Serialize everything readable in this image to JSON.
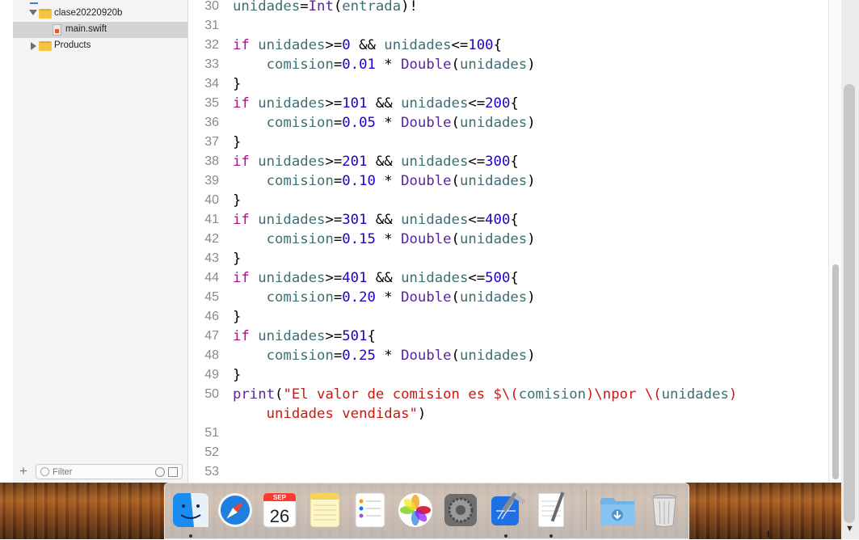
{
  "navigator": {
    "items": [
      {
        "label": "clase20220920b",
        "kind": "group"
      },
      {
        "label": "main.swift",
        "kind": "file"
      },
      {
        "label": "Products",
        "kind": "group"
      }
    ],
    "filter_placeholder": "Filter"
  },
  "editor": {
    "lines": [
      {
        "n": "30",
        "tokens": [
          {
            "t": "unidades",
            "c": "id"
          },
          {
            "t": "=",
            "c": "p"
          },
          {
            "t": "Int",
            "c": "ty"
          },
          {
            "t": "(",
            "c": "p"
          },
          {
            "t": "entrada",
            "c": "id"
          },
          {
            "t": ")!",
            "c": "p"
          }
        ]
      },
      {
        "n": "31",
        "tokens": []
      },
      {
        "n": "32",
        "tokens": [
          {
            "t": "if",
            "c": "kw"
          },
          {
            "t": " ",
            "c": "p"
          },
          {
            "t": "unidades",
            "c": "id"
          },
          {
            "t": ">=",
            "c": "p"
          },
          {
            "t": "0",
            "c": "num"
          },
          {
            "t": " && ",
            "c": "p"
          },
          {
            "t": "unidades",
            "c": "id"
          },
          {
            "t": "<=",
            "c": "p"
          },
          {
            "t": "100",
            "c": "num"
          },
          {
            "t": "{",
            "c": "p"
          }
        ]
      },
      {
        "n": "33",
        "tokens": [
          {
            "t": "    ",
            "c": "p"
          },
          {
            "t": "comision",
            "c": "id"
          },
          {
            "t": "=",
            "c": "p"
          },
          {
            "t": "0.01",
            "c": "num"
          },
          {
            "t": " * ",
            "c": "p"
          },
          {
            "t": "Double",
            "c": "ty"
          },
          {
            "t": "(",
            "c": "p"
          },
          {
            "t": "unidades",
            "c": "id"
          },
          {
            "t": ")",
            "c": "p"
          }
        ]
      },
      {
        "n": "34",
        "tokens": [
          {
            "t": "}",
            "c": "p"
          }
        ]
      },
      {
        "n": "35",
        "tokens": [
          {
            "t": "if",
            "c": "kw"
          },
          {
            "t": " ",
            "c": "p"
          },
          {
            "t": "unidades",
            "c": "id"
          },
          {
            "t": ">=",
            "c": "p"
          },
          {
            "t": "101",
            "c": "num"
          },
          {
            "t": " && ",
            "c": "p"
          },
          {
            "t": "unidades",
            "c": "id"
          },
          {
            "t": "<=",
            "c": "p"
          },
          {
            "t": "200",
            "c": "num"
          },
          {
            "t": "{",
            "c": "p"
          }
        ]
      },
      {
        "n": "36",
        "tokens": [
          {
            "t": "    ",
            "c": "p"
          },
          {
            "t": "comision",
            "c": "id"
          },
          {
            "t": "=",
            "c": "p"
          },
          {
            "t": "0.05",
            "c": "num"
          },
          {
            "t": " * ",
            "c": "p"
          },
          {
            "t": "Double",
            "c": "ty"
          },
          {
            "t": "(",
            "c": "p"
          },
          {
            "t": "unidades",
            "c": "id"
          },
          {
            "t": ")",
            "c": "p"
          }
        ]
      },
      {
        "n": "37",
        "tokens": [
          {
            "t": "}",
            "c": "p"
          }
        ]
      },
      {
        "n": "38",
        "tokens": [
          {
            "t": "if",
            "c": "kw"
          },
          {
            "t": " ",
            "c": "p"
          },
          {
            "t": "unidades",
            "c": "id"
          },
          {
            "t": ">=",
            "c": "p"
          },
          {
            "t": "201",
            "c": "num"
          },
          {
            "t": " && ",
            "c": "p"
          },
          {
            "t": "unidades",
            "c": "id"
          },
          {
            "t": "<=",
            "c": "p"
          },
          {
            "t": "300",
            "c": "num"
          },
          {
            "t": "{",
            "c": "p"
          }
        ]
      },
      {
        "n": "39",
        "tokens": [
          {
            "t": "    ",
            "c": "p"
          },
          {
            "t": "comision",
            "c": "id"
          },
          {
            "t": "=",
            "c": "p"
          },
          {
            "t": "0.10",
            "c": "num"
          },
          {
            "t": " * ",
            "c": "p"
          },
          {
            "t": "Double",
            "c": "ty"
          },
          {
            "t": "(",
            "c": "p"
          },
          {
            "t": "unidades",
            "c": "id"
          },
          {
            "t": ")",
            "c": "p"
          }
        ]
      },
      {
        "n": "40",
        "tokens": [
          {
            "t": "}",
            "c": "p"
          }
        ]
      },
      {
        "n": "41",
        "tokens": [
          {
            "t": "if",
            "c": "kw"
          },
          {
            "t": " ",
            "c": "p"
          },
          {
            "t": "unidades",
            "c": "id"
          },
          {
            "t": ">=",
            "c": "p"
          },
          {
            "t": "301",
            "c": "num"
          },
          {
            "t": " && ",
            "c": "p"
          },
          {
            "t": "unidades",
            "c": "id"
          },
          {
            "t": "<=",
            "c": "p"
          },
          {
            "t": "400",
            "c": "num"
          },
          {
            "t": "{",
            "c": "p"
          }
        ]
      },
      {
        "n": "42",
        "tokens": [
          {
            "t": "    ",
            "c": "p"
          },
          {
            "t": "comision",
            "c": "id"
          },
          {
            "t": "=",
            "c": "p"
          },
          {
            "t": "0.15",
            "c": "num"
          },
          {
            "t": " * ",
            "c": "p"
          },
          {
            "t": "Double",
            "c": "ty"
          },
          {
            "t": "(",
            "c": "p"
          },
          {
            "t": "unidades",
            "c": "id"
          },
          {
            "t": ")",
            "c": "p"
          }
        ]
      },
      {
        "n": "43",
        "tokens": [
          {
            "t": "}",
            "c": "p"
          }
        ]
      },
      {
        "n": "44",
        "tokens": [
          {
            "t": "if",
            "c": "kw"
          },
          {
            "t": " ",
            "c": "p"
          },
          {
            "t": "unidades",
            "c": "id"
          },
          {
            "t": ">=",
            "c": "p"
          },
          {
            "t": "401",
            "c": "num"
          },
          {
            "t": " && ",
            "c": "p"
          },
          {
            "t": "unidades",
            "c": "id"
          },
          {
            "t": "<=",
            "c": "p"
          },
          {
            "t": "500",
            "c": "num"
          },
          {
            "t": "{",
            "c": "p"
          }
        ]
      },
      {
        "n": "45",
        "tokens": [
          {
            "t": "    ",
            "c": "p"
          },
          {
            "t": "comision",
            "c": "id"
          },
          {
            "t": "=",
            "c": "p"
          },
          {
            "t": "0.20",
            "c": "num"
          },
          {
            "t": " * ",
            "c": "p"
          },
          {
            "t": "Double",
            "c": "ty"
          },
          {
            "t": "(",
            "c": "p"
          },
          {
            "t": "unidades",
            "c": "id"
          },
          {
            "t": ")",
            "c": "p"
          }
        ]
      },
      {
        "n": "46",
        "tokens": [
          {
            "t": "}",
            "c": "p"
          }
        ]
      },
      {
        "n": "47",
        "tokens": [
          {
            "t": "if",
            "c": "kw"
          },
          {
            "t": " ",
            "c": "p"
          },
          {
            "t": "unidades",
            "c": "id"
          },
          {
            "t": ">=",
            "c": "p"
          },
          {
            "t": "501",
            "c": "num"
          },
          {
            "t": "{",
            "c": "p"
          }
        ]
      },
      {
        "n": "48",
        "tokens": [
          {
            "t": "    ",
            "c": "p"
          },
          {
            "t": "comision",
            "c": "id"
          },
          {
            "t": "=",
            "c": "p"
          },
          {
            "t": "0.25",
            "c": "num"
          },
          {
            "t": " * ",
            "c": "p"
          },
          {
            "t": "Double",
            "c": "ty"
          },
          {
            "t": "(",
            "c": "p"
          },
          {
            "t": "unidades",
            "c": "id"
          },
          {
            "t": ")",
            "c": "p"
          }
        ]
      },
      {
        "n": "49",
        "tokens": [
          {
            "t": "}",
            "c": "p"
          }
        ]
      },
      {
        "n": "50",
        "tokens": [
          {
            "t": "print",
            "c": "ty"
          },
          {
            "t": "(",
            "c": "p"
          },
          {
            "t": "\"El valor de comision es $\\(",
            "c": "str"
          },
          {
            "t": "comision",
            "c": "id"
          },
          {
            "t": ")\\npor \\(",
            "c": "str"
          },
          {
            "t": "unidades",
            "c": "id"
          },
          {
            "t": ")",
            "c": "str"
          }
        ]
      },
      {
        "n": "",
        "tokens": [
          {
            "t": "    ",
            "c": "p"
          },
          {
            "t": "unidades vendidas\"",
            "c": "str"
          },
          {
            "t": ")",
            "c": "p"
          }
        ]
      },
      {
        "n": "51",
        "tokens": []
      },
      {
        "n": "52",
        "tokens": []
      },
      {
        "n": "53",
        "tokens": []
      }
    ]
  },
  "dock": {
    "calendar": {
      "month": "SEP",
      "day": "26"
    },
    "apps": [
      "finder-icon",
      "safari-icon",
      "calendar-icon",
      "notes-icon",
      "reminders-icon",
      "photos-icon",
      "system-preferences-icon",
      "xcode-icon",
      "textedit-icon",
      "downloads-folder-icon",
      "trash-icon"
    ]
  },
  "colors": {
    "keyword": "#aa0d91",
    "identifier": "#3f6e74",
    "number": "#1c00cf",
    "type": "#5c2699",
    "string": "#c41a16"
  }
}
